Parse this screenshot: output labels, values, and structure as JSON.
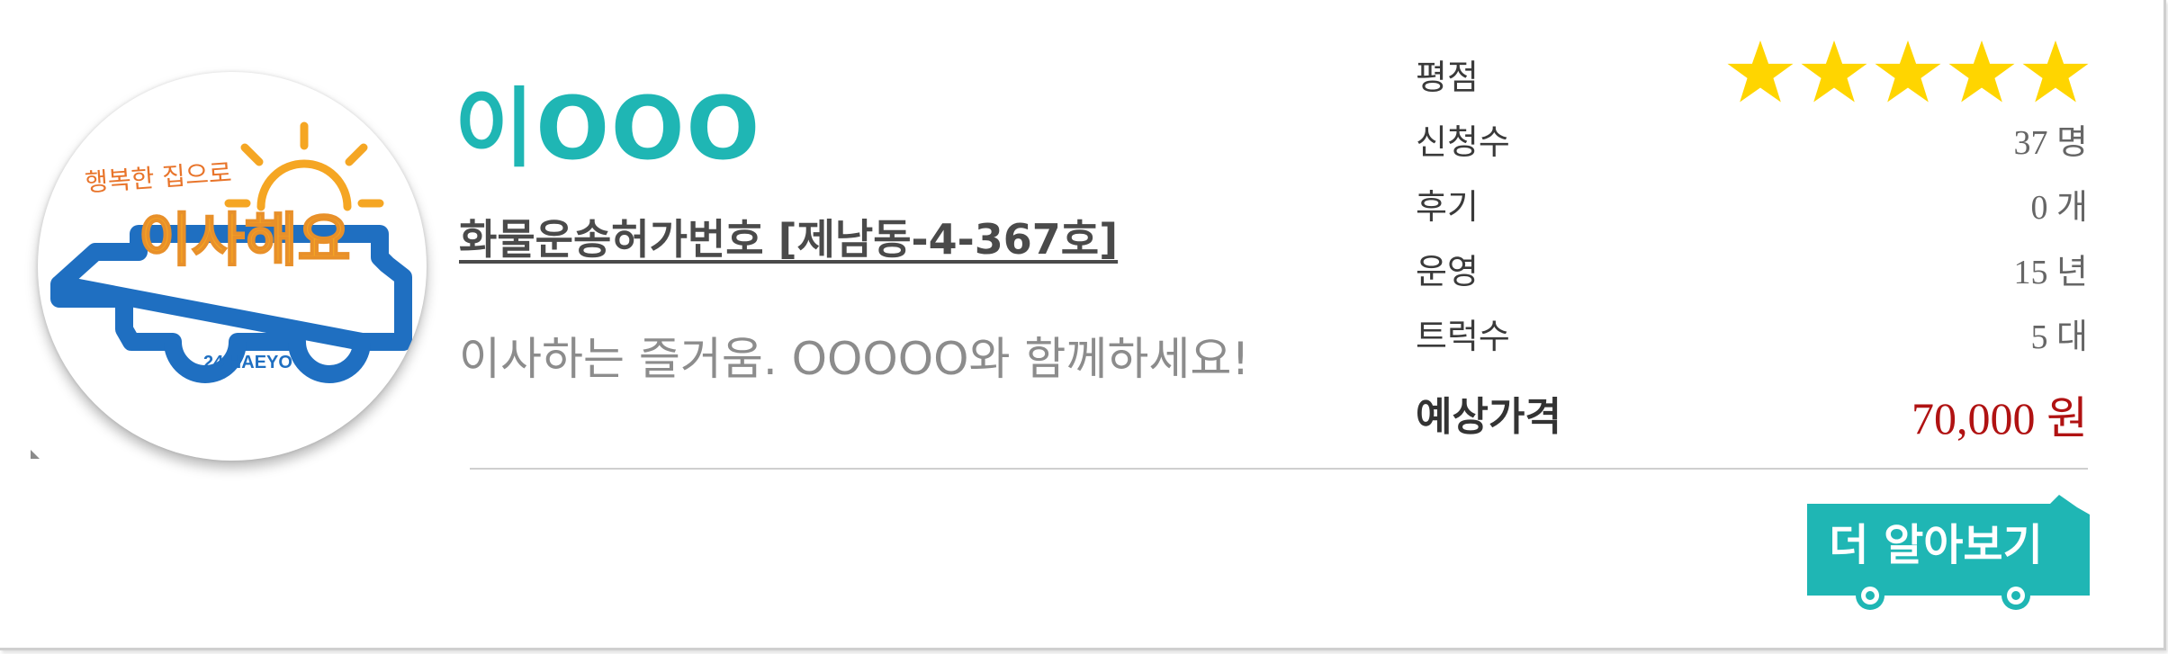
{
  "company": {
    "name": "이OOO",
    "license": "화물운송허가번호 [제남동-4-367호]",
    "slogan": "이사하는 즐거움. OOOOO와 함께하세요!"
  },
  "logo": {
    "tagline": "행복한 집으로",
    "brand": "이사해요",
    "sub": "24 HAEYO",
    "colors": {
      "blue": "#1f6fc1",
      "orange": "#f5a623",
      "text_orange": "#e8742a"
    }
  },
  "stats": {
    "rating_label": "평점",
    "rating_value": 5,
    "rating_max": 5,
    "rating_icon": "star-icon",
    "rows": [
      {
        "label": "신청수",
        "value": "37 명"
      },
      {
        "label": "후기",
        "value": "0 개"
      },
      {
        "label": "운영",
        "value": "15 년"
      },
      {
        "label": "트럭수",
        "value": "5 대"
      }
    ],
    "price_label": "예상가격",
    "price_value": "70,000 원"
  },
  "button": {
    "label": "더 알아보기",
    "icon": "truck-icon",
    "color": "#1fb6b4"
  },
  "colors": {
    "accent": "#1fb6b4",
    "price": "#b01212",
    "star": "#ffd500"
  }
}
